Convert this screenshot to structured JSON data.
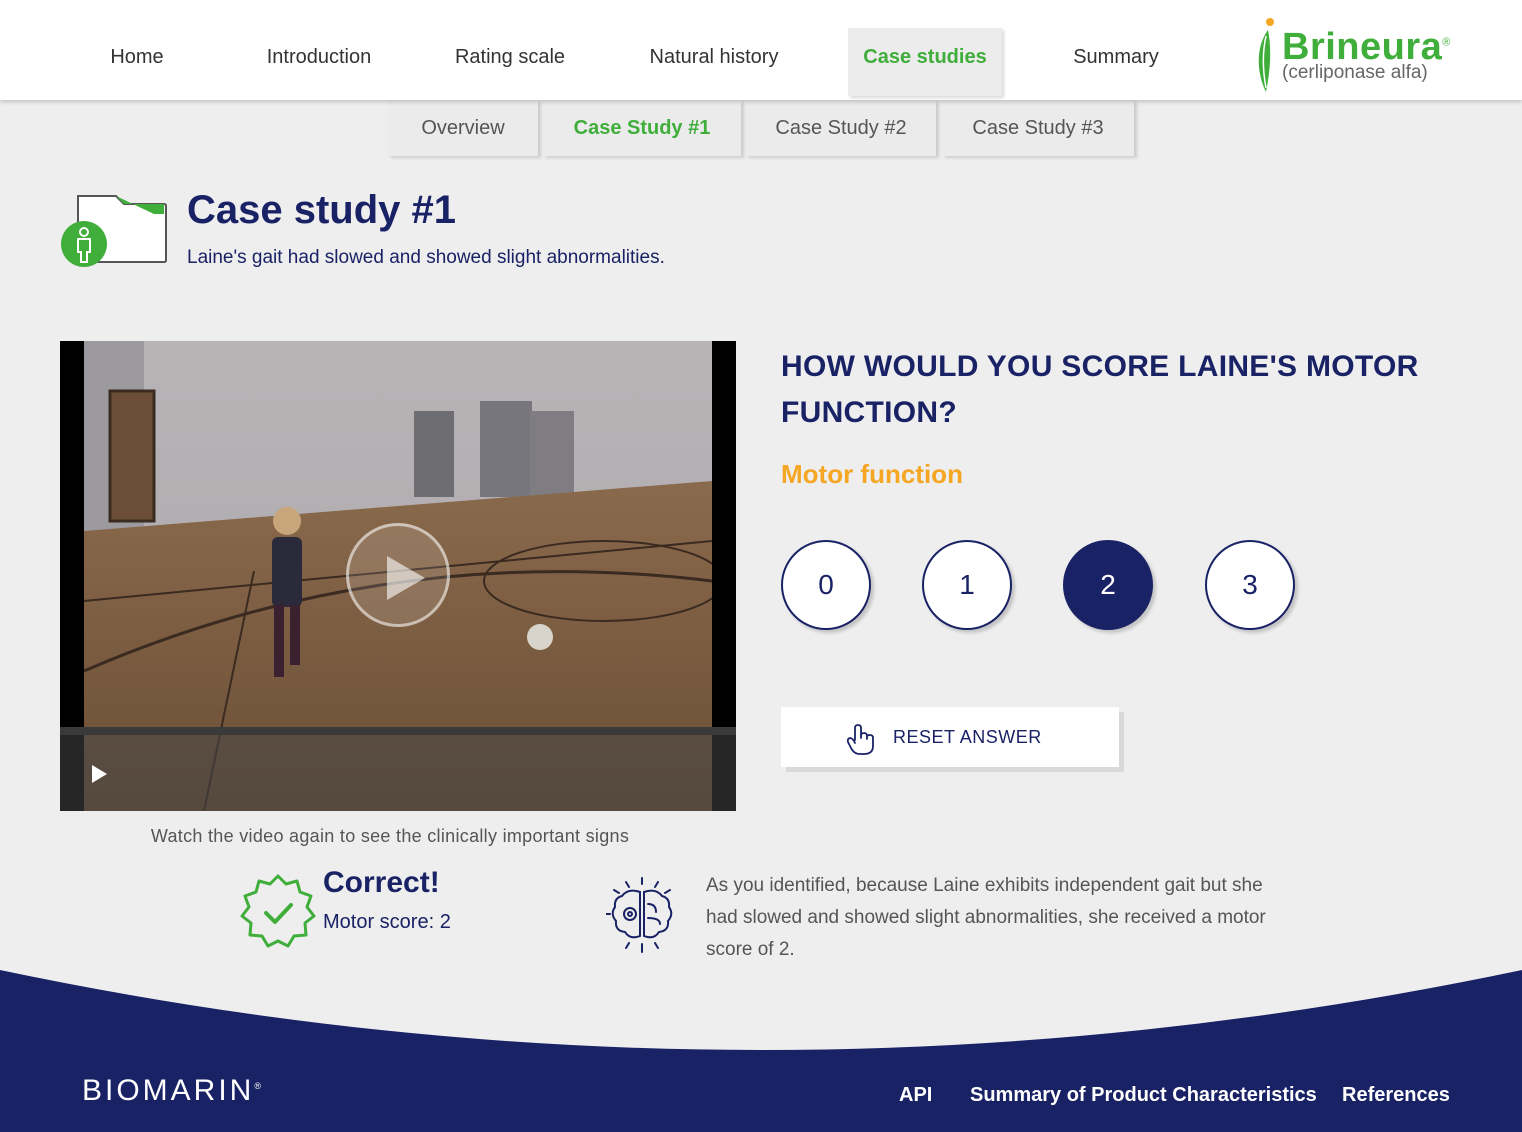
{
  "nav": {
    "items": [
      {
        "label": "Home",
        "active": false
      },
      {
        "label": "Introduction",
        "active": false
      },
      {
        "label": "Rating scale",
        "active": false
      },
      {
        "label": "Natural history",
        "active": false
      },
      {
        "label": "Case studies",
        "active": true
      },
      {
        "label": "Summary",
        "active": false
      }
    ]
  },
  "brand": {
    "name": "Brineura",
    "subtitle": "(cerliponase alfa)"
  },
  "subnav": {
    "items": [
      {
        "label": "Overview",
        "active": false
      },
      {
        "label": "Case Study #1",
        "active": true
      },
      {
        "label": "Case Study #2",
        "active": false
      },
      {
        "label": "Case Study #3",
        "active": false
      }
    ]
  },
  "page": {
    "title": "Case study #1",
    "subtitle": "Laine's gait had slowed and showed slight abnormalities."
  },
  "video": {
    "caption": "Watch the video again to see the clinically important signs"
  },
  "question": {
    "text": "HOW WOULD YOU SCORE LAINE'S MOTOR FUNCTION?",
    "category": "Motor function",
    "options": [
      "0",
      "1",
      "2",
      "3"
    ],
    "selected": "2",
    "reset_label": "RESET ANSWER"
  },
  "feedback": {
    "title": "Correct!",
    "score": "Motor score: 2",
    "explanation": "As you identified, because Laine exhibits independent gait but she had slowed and showed slight abnormalities, she received a motor score of 2."
  },
  "footer": {
    "logo": "BIOMARIN",
    "links": [
      "API",
      "Summary of Product Characteristics",
      "References"
    ]
  },
  "colors": {
    "brand_green": "#3fae3a",
    "navy": "#1a2266",
    "accent_orange": "#f5a623",
    "background": "#eeeeee"
  }
}
